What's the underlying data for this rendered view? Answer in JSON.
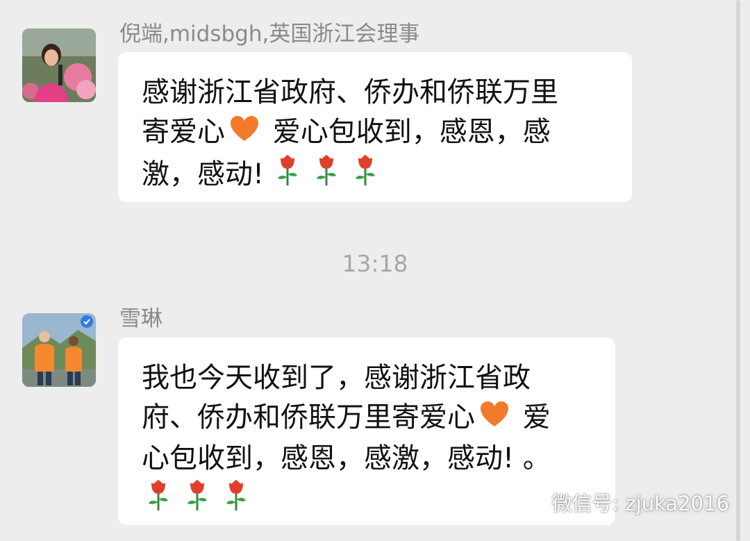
{
  "messages": [
    {
      "sender": "倪端,midsbgh,英国浙江会理事",
      "lines": [
        "感谢浙江省政府、侨办和侨联万里",
        "寄爱心",
        " 爱心包收到，感恩，感",
        "激，感动!"
      ]
    },
    {
      "sender": "雪琳",
      "lines": [
        "我也今天收到了，感谢浙江省政",
        "府、侨办和侨联万里寄爱心",
        " 爱",
        "心包收到，感恩，感激，感动! 。"
      ]
    }
  ],
  "timestamp": "13:18",
  "watermark": "微信号: zjuka2016",
  "icons": {
    "heart": "orange-heart-icon",
    "rose": "rose-icon",
    "wechat": "wechat-icon"
  },
  "colors": {
    "background": "#ededed",
    "bubble": "#ffffff",
    "heart": "#f37a2a",
    "rose": "#e0402b"
  }
}
